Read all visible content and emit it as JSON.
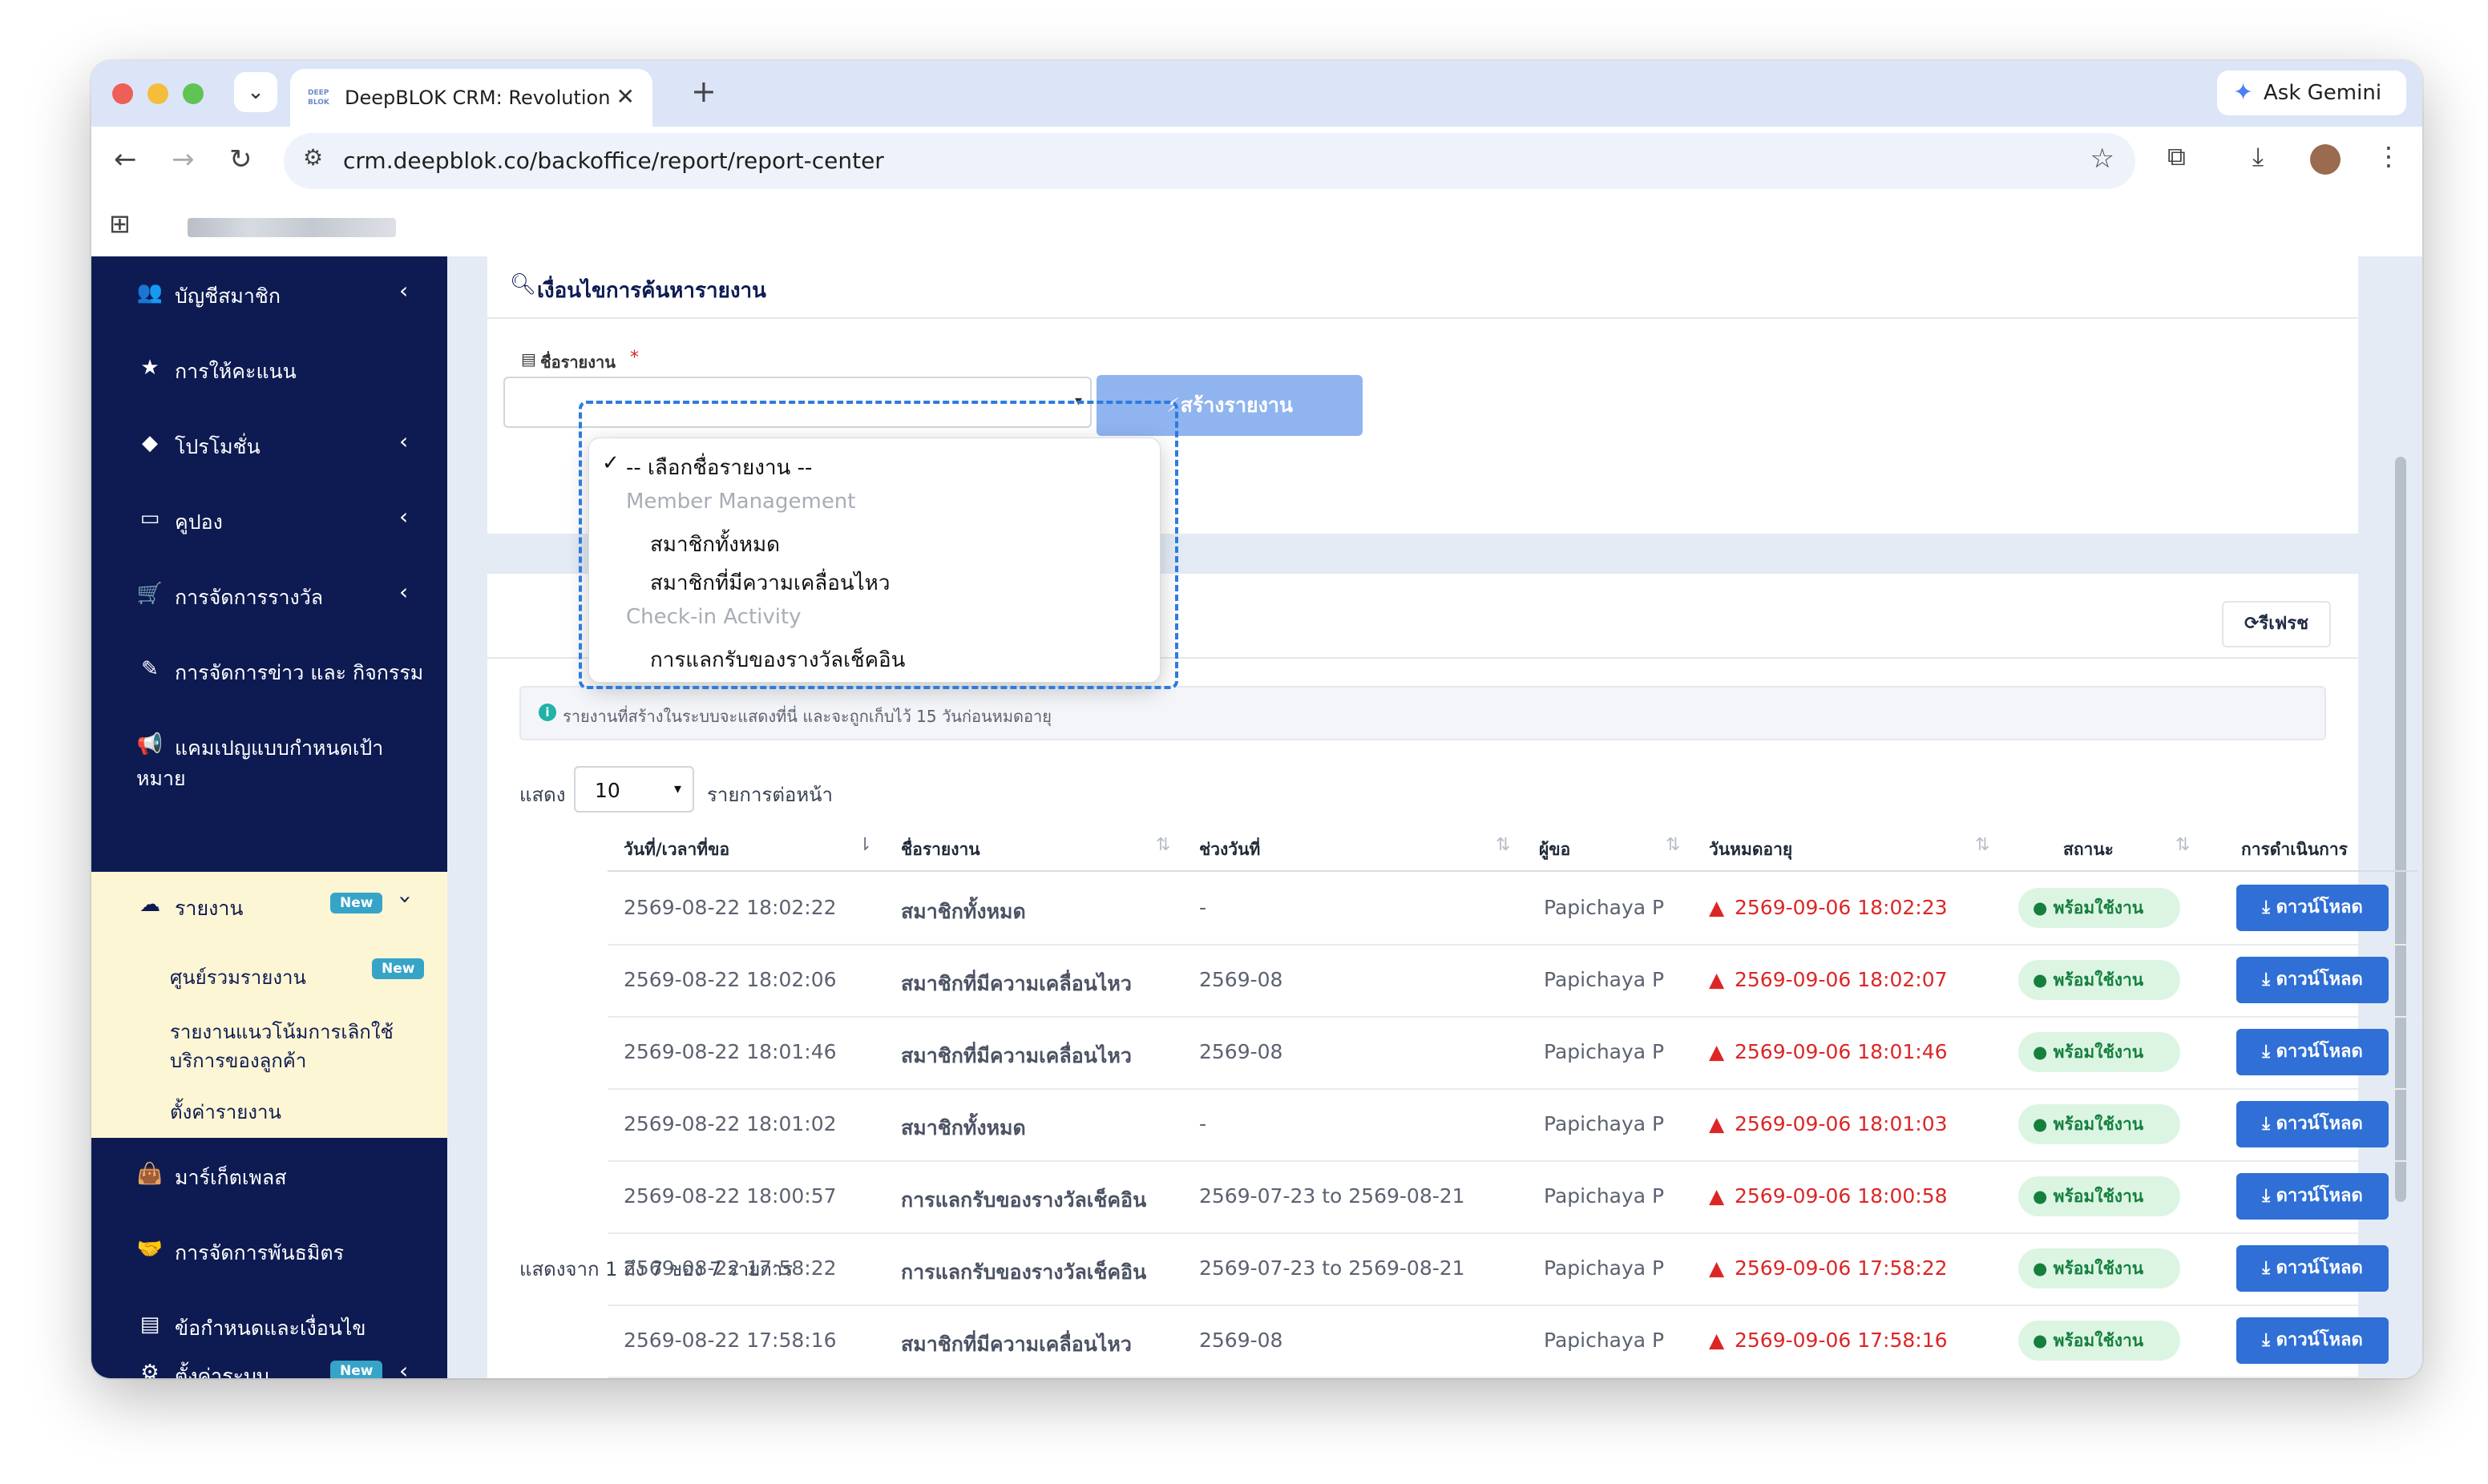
{
  "browser": {
    "tab_title": "DeepBLOK CRM: Revolutioniz",
    "tab_favicon_text": "DEEP BLOK",
    "url": "crm.deepblok.co/backoffice/report/report-center",
    "ask_gemini": "Ask Gemini"
  },
  "sidebar": {
    "items": [
      {
        "label": "บัญชีสมาชิก",
        "icon": "users-icon"
      },
      {
        "label": "การให้คะแนน",
        "icon": "star-icon"
      },
      {
        "label": "โปรโมชั่น",
        "icon": "tag-icon"
      },
      {
        "label": "คูปอง",
        "icon": "ticket-icon"
      },
      {
        "label": "การจัดการรางวัล",
        "icon": "cart-icon"
      },
      {
        "label": "การจัดการข่าว และ กิจกรรม",
        "icon": "edit-icon"
      },
      {
        "label": "แคมเปญแบบกำหนดเป้า",
        "label2": "หมาย",
        "icon": "megaphone-icon"
      },
      {
        "label": "รายงาน",
        "icon": "cloud-download-icon",
        "badge": "New"
      },
      {
        "label": "มาร์เก็ตเพลส",
        "icon": "bag-icon"
      },
      {
        "label": "การจัดการพันธมิตร",
        "icon": "handshake-icon"
      },
      {
        "label": "ข้อกำหนดและเงื่อนไข",
        "icon": "file-icon"
      },
      {
        "label": "ตั้งค่าระบบ",
        "icon": "gear-icon",
        "badge": "New"
      }
    ],
    "report_sub": [
      {
        "label": "ศูนย์รวมรายงาน",
        "badge": "New"
      },
      {
        "label": "รายงานแนวโน้มการเลิกใช้",
        "label2": "บริการของลูกค้า"
      },
      {
        "label": "ตั้งค่ารายงาน"
      }
    ]
  },
  "search_card": {
    "title": "เงื่อนไขการค้นหารายงาน",
    "field_label": "ชื่อรายงาน",
    "required_mark": "*",
    "create_button": "สร้างรายงาน"
  },
  "dropdown": {
    "selected": "-- เลือกชื่อรายงาน --",
    "groups": [
      {
        "name": "Member Management",
        "options": [
          "สมาชิกทั้งหมด",
          "สมาชิกที่มีความเคลื่อนไหว"
        ]
      },
      {
        "name": "Check-in Activity",
        "options": [
          "การแลกรับของรางวัลเช็คอิน"
        ]
      }
    ]
  },
  "list_card": {
    "refresh_button": "รีเฟรช",
    "info_text": "รายงานที่สร้างในระบบจะแสดงที่นี่ และจะถูกเก็บไว้ 15 วันก่อนหมดอายุ",
    "show_label": "แสดง",
    "page_size": "10",
    "per_page_label": "รายการต่อหน้า",
    "columns": [
      "วันที่/เวลาที่ขอ",
      "ชื่อรายงาน",
      "ช่วงวันที่",
      "ผู้ขอ",
      "วันหมดอายุ",
      "สถานะ",
      "การดำเนินการ"
    ],
    "rows": [
      {
        "requested": "2569-08-22 18:02:22",
        "name": "สมาชิกทั้งหมด",
        "range": "-",
        "requester": "Papichaya P",
        "expires": "2569-09-06 18:02:23",
        "status": "พร้อมใช้งาน",
        "action": "ดาวน์โหลด"
      },
      {
        "requested": "2569-08-22 18:02:06",
        "name": "สมาชิกที่มีความเคลื่อนไหว",
        "range": "2569-08",
        "requester": "Papichaya P",
        "expires": "2569-09-06 18:02:07",
        "status": "พร้อมใช้งาน",
        "action": "ดาวน์โหลด"
      },
      {
        "requested": "2569-08-22 18:01:46",
        "name": "สมาชิกที่มีความเคลื่อนไหว",
        "range": "2569-08",
        "requester": "Papichaya P",
        "expires": "2569-09-06 18:01:46",
        "status": "พร้อมใช้งาน",
        "action": "ดาวน์โหลด"
      },
      {
        "requested": "2569-08-22 18:01:02",
        "name": "สมาชิกทั้งหมด",
        "range": "-",
        "requester": "Papichaya P",
        "expires": "2569-09-06 18:01:03",
        "status": "พร้อมใช้งาน",
        "action": "ดาวน์โหลด"
      },
      {
        "requested": "2569-08-22 18:00:57",
        "name": "การแลกรับของรางวัลเช็คอิน",
        "range": "2569-07-23 to 2569-08-21",
        "requester": "Papichaya P",
        "expires": "2569-09-06 18:00:58",
        "status": "พร้อมใช้งาน",
        "action": "ดาวน์โหลด"
      },
      {
        "requested": "2569-08-22 17:58:22",
        "name": "การแลกรับของรางวัลเช็คอิน",
        "range": "2569-07-23 to 2569-08-21",
        "requester": "Papichaya P",
        "expires": "2569-09-06 17:58:22",
        "status": "พร้อมใช้งาน",
        "action": "ดาวน์โหลด"
      },
      {
        "requested": "2569-08-22 17:58:16",
        "name": "สมาชิกที่มีความเคลื่อนไหว",
        "range": "2569-08",
        "requester": "Papichaya P",
        "expires": "2569-09-06 17:58:16",
        "status": "พร้อมใช้งาน",
        "action": "ดาวน์โหลด"
      }
    ],
    "footer": "แสดงจาก 1 ถึง 7 ของ 7 รายการ"
  }
}
